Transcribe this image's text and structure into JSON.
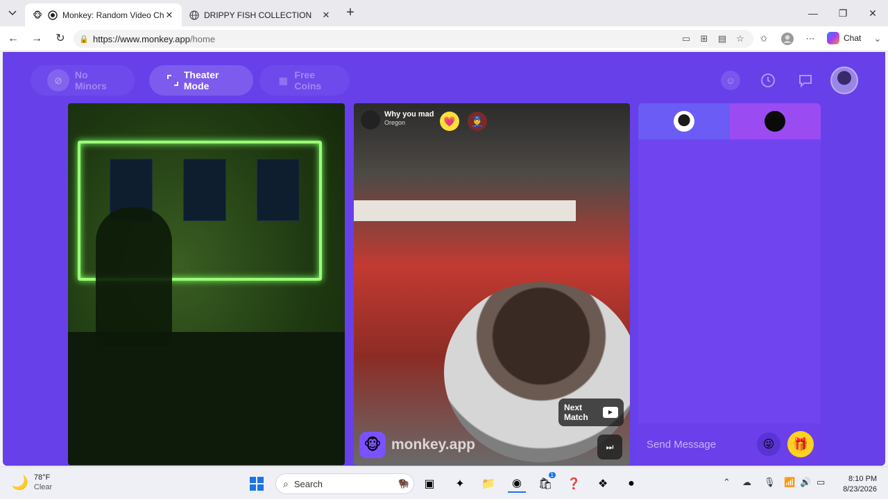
{
  "browser": {
    "tabs": [
      {
        "title": "Monkey: Random Video Chat",
        "favicon": "monkey-icon"
      },
      {
        "title": "DRIPPY FISH COLLECTION",
        "favicon": "globe-icon"
      }
    ],
    "url_host": "https://www.monkey.app",
    "url_path": "/home",
    "copilot_label": "Chat"
  },
  "monkey": {
    "toolbar": {
      "no_minors": "No Minors",
      "theater_mode": "Theater Mode",
      "free_coins": "Free Coins"
    },
    "peer": {
      "name": "Why you mad",
      "location": "Oregon"
    },
    "next_match": "Next Match",
    "brand": "monkey.app",
    "chat_placeholder": "Send Message",
    "colors": {
      "bg": "#6740ea",
      "accent": "#ffd21f"
    }
  },
  "taskbar": {
    "weather_temp": "78°F",
    "weather_desc": "Clear",
    "search_label": "Search",
    "time": "8:10 PM",
    "date": "8/23/2026",
    "store_badge": "1"
  }
}
